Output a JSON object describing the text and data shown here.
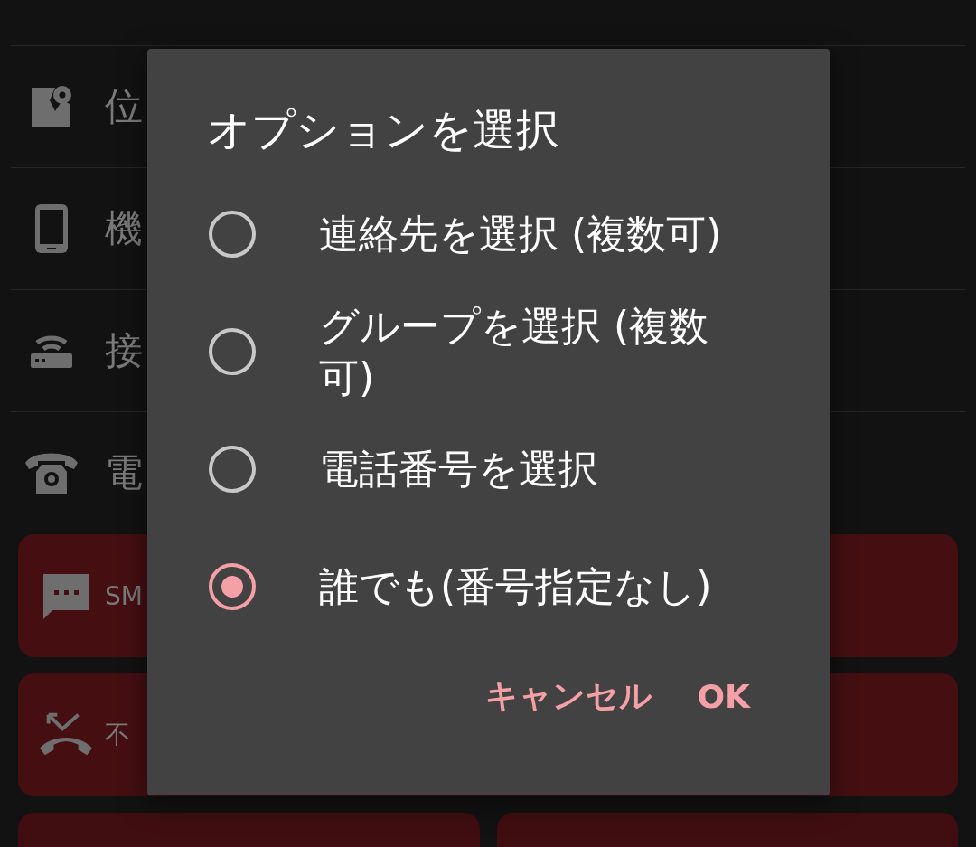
{
  "settings_list": [
    {
      "kind": "map",
      "label": "位"
    },
    {
      "kind": "phone",
      "label": "機"
    },
    {
      "kind": "router",
      "label": "接"
    },
    {
      "kind": "telephone",
      "label": "電"
    }
  ],
  "action_cards": [
    {
      "kind": "sms",
      "label": "SM"
    },
    {
      "kind": "missed",
      "label": "不"
    }
  ],
  "dialog": {
    "title": "オプションを選択",
    "options": [
      {
        "label": "連絡先を選択 (複数可)",
        "selected": false
      },
      {
        "label": "グループを選択 (複数可)",
        "selected": false
      },
      {
        "label": "電話番号を選択",
        "selected": false
      },
      {
        "label": "誰でも(番号指定なし)",
        "selected": true
      }
    ],
    "buttons": [
      "キャンセル",
      "OK"
    ]
  }
}
